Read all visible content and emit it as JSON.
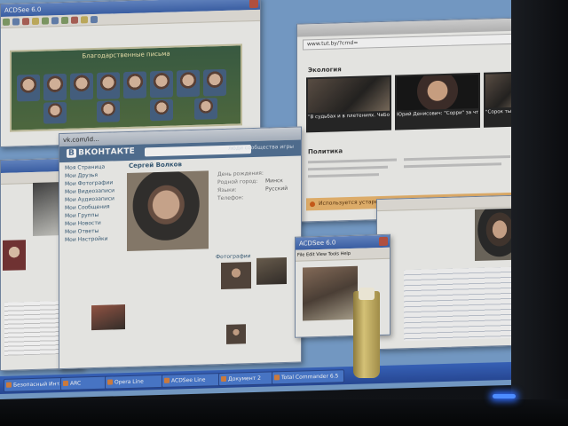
{
  "acdsee_top": {
    "title": "ACDSee 6.0",
    "banner": "Благодарственные письма"
  },
  "vk": {
    "url": "vk.com/id...",
    "logo": "ВКОНТАКТЕ",
    "logo_box": "В",
    "nav": "люди  сообщества  игры",
    "user_name": "Сергей Волков",
    "menu": [
      "Моя Страница",
      "Мои Друзья",
      "Мои Фотографии",
      "Мои Видеозаписи",
      "Мои Аудиозаписи",
      "Мои Сообщения",
      "Мои Группы",
      "Мои Новости",
      "Мои Ответы",
      "Мои Настройки"
    ],
    "info": [
      {
        "k": "День рождения:",
        "v": ""
      },
      {
        "k": "Родной город:",
        "v": "Минск"
      },
      {
        "k": "Языки:",
        "v": "Русский"
      },
      {
        "k": "Телефон:",
        "v": ""
      }
    ],
    "photos_label": "Фотографии"
  },
  "news": {
    "url": "www.tut.by/?crnd=",
    "section1": "Экология",
    "section2": "Политика",
    "tile1": "\"В судьбах и в плетениях. ЧаБоБи?\" Как в минуте появились возле советской медальной",
    "tile2": "Юрий Денисович: \"Сорри\" за что ишь ведь \"Дете Чаки\"",
    "tile3": "\"Сорок тысяч\" о \"Дете Чаки\"",
    "warning": "Используется устаревшая версия браузера. Установите новую версию для безопасности."
  },
  "acdsee_small": {
    "title": "ACDSee 6.0",
    "menu": "File Edit View Tools Help"
  },
  "taskbar": {
    "buttons": [
      "Безопасный Инт...",
      "ARC",
      "Opera Line",
      "ACDSee Line",
      "Документ 2",
      "Total Commander 6.5"
    ]
  }
}
